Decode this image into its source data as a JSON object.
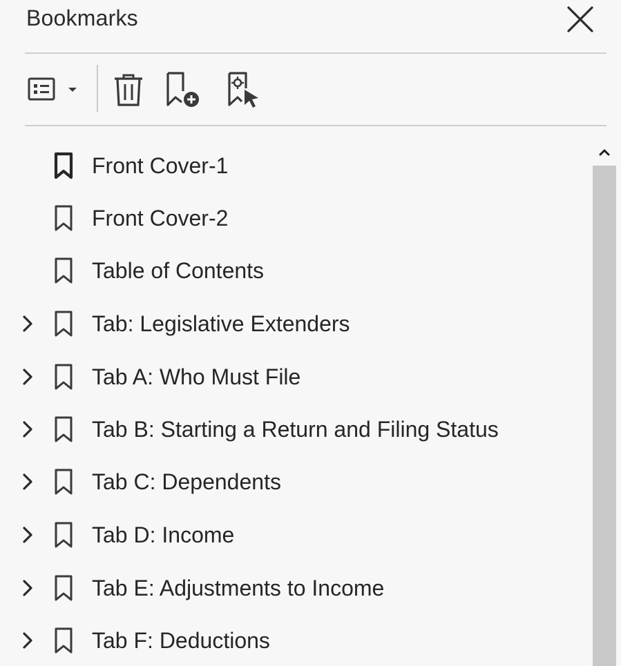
{
  "panel": {
    "title": "Bookmarks",
    "close_icon": "close-icon"
  },
  "toolbar": {
    "options_icon": "options-list-icon",
    "delete_icon": "trash-icon",
    "new_bookmark_icon": "add-bookmark-icon",
    "bookmark_from_selection_icon": "bookmark-selection-icon"
  },
  "bookmarks": [
    {
      "label": "Front Cover-1",
      "expandable": false,
      "active": true
    },
    {
      "label": "Front Cover-2",
      "expandable": false,
      "active": false
    },
    {
      "label": "Table of Contents",
      "expandable": false,
      "active": false
    },
    {
      "label": "Tab: Legislative Extenders",
      "expandable": true,
      "active": false
    },
    {
      "label": "Tab A: Who Must File",
      "expandable": true,
      "active": false
    },
    {
      "label": "Tab B: Starting a Return and Filing Status",
      "expandable": true,
      "active": false
    },
    {
      "label": "Tab C: Dependents",
      "expandable": true,
      "active": false
    },
    {
      "label": "Tab D: Income",
      "expandable": true,
      "active": false
    },
    {
      "label": "Tab E: Adjustments to Income",
      "expandable": true,
      "active": false
    },
    {
      "label": "Tab F: Deductions",
      "expandable": true,
      "active": false
    }
  ],
  "colors": {
    "background": "#f7f7f7",
    "divider": "#cfcfcf",
    "scroll_thumb": "#c8c8c8",
    "icon": "#3a3a3a"
  }
}
